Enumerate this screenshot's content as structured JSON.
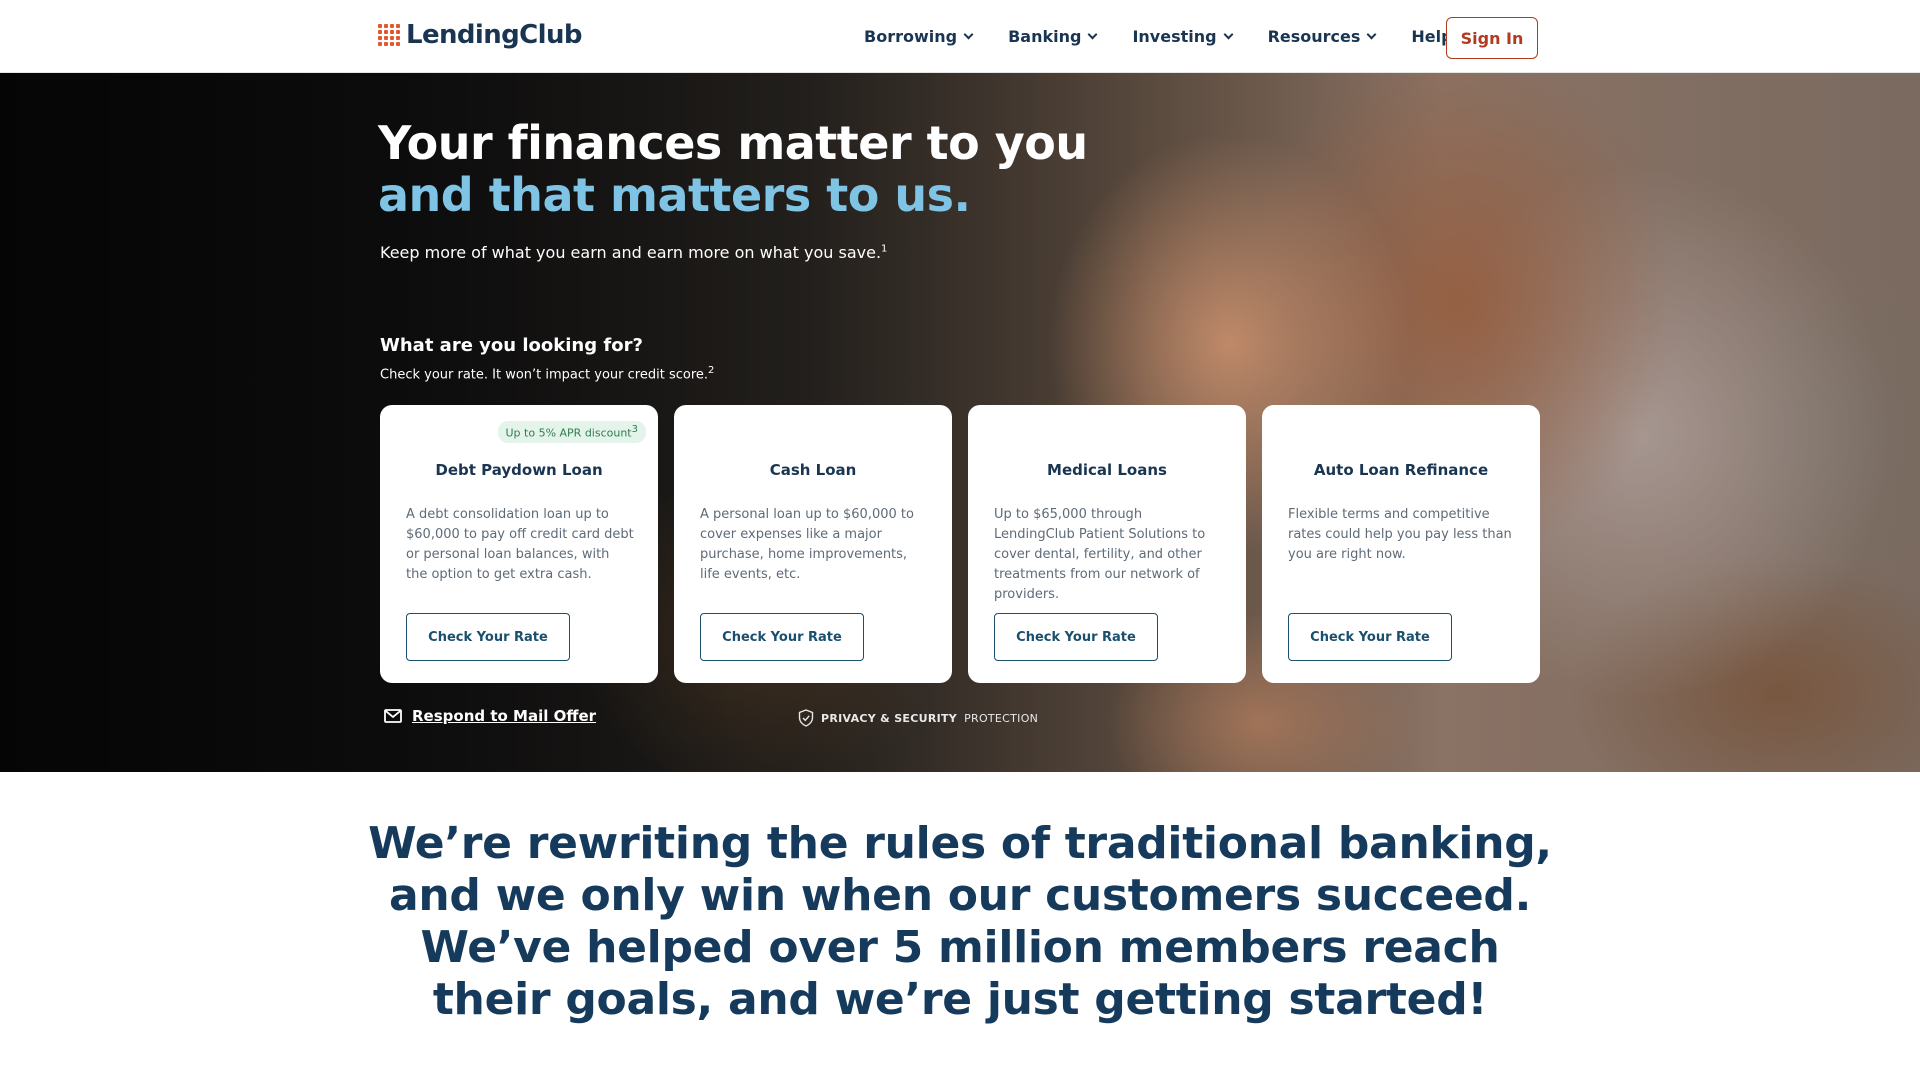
{
  "header": {
    "logo_text": "LendingClub",
    "nav": [
      "Borrowing",
      "Banking",
      "Investing",
      "Resources",
      "Help"
    ],
    "signin_label": "Sign In"
  },
  "hero": {
    "title_line1": "Your finances matter to you",
    "title_line2": "and that matters to us.",
    "subtitle": "Keep more of what you earn and earn more on what you save.",
    "subtitle_sup": "1",
    "looking_title": "What are you looking for?",
    "looking_sub": "Check your rate. It won’t impact your credit score.",
    "looking_sup": "2",
    "cards": [
      {
        "badge": "Up to 5% APR discount",
        "badge_sup": "3",
        "title": "Debt Paydown Loan",
        "desc": "A debt consolidation loan up to $60,000 to pay off credit card debt or personal loan balances, with the option to get extra cash.",
        "button": "Check Your Rate"
      },
      {
        "title": "Cash Loan",
        "desc": "A personal loan up to $60,000 to cover expenses like a major purchase, home improvements, life events, etc.",
        "button": "Check Your Rate"
      },
      {
        "title": "Medical Loans",
        "desc": "Up to $65,000 through LendingClub Patient Solutions to cover dental, fertility, and other treatments from our network of providers.",
        "button": "Check Your Rate"
      },
      {
        "title": "Auto Loan Refinance",
        "desc": "Flexible terms and competitive rates could help you pay less than you are right now.",
        "button": "Check Your Rate"
      }
    ],
    "mail_link": "Respond to Mail Offer",
    "privacy_bold": "PRIVACY & SECURITY",
    "privacy_rest": "PROTECTION"
  },
  "mission": {
    "text": "We’re rewriting the rules of traditional banking, and we only win when our customers succeed. We’ve helped over 5 million members reach their goals, and we’re just getting started!"
  },
  "colors": {
    "navy": "#1a3552",
    "accent_blue": "#7fc4e4",
    "signin_red": "#b23a1e",
    "logo_orange": "#e2582c"
  }
}
